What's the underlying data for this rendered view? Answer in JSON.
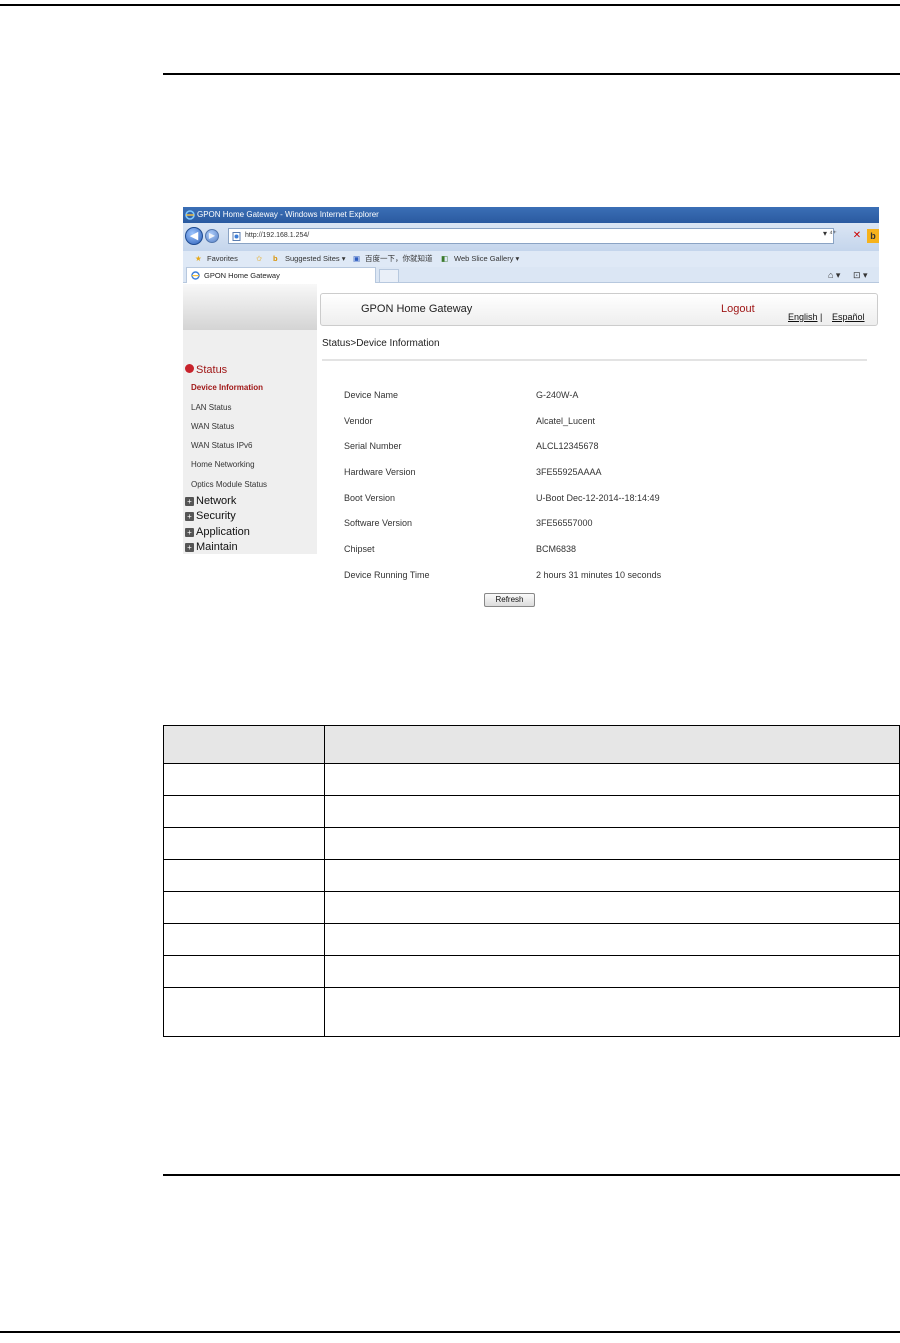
{
  "browser": {
    "window_title": "GPON Home Gateway - Windows Internet Explorer",
    "address": "http://192.168.1.254/",
    "favorites_label": "Favorites",
    "suggested_sites": "Suggested Sites ▾",
    "baidu_label": "百度一下，你就知道",
    "web_slice_gallery": "Web Slice Gallery ▾",
    "tab_label": "GPON Home Gateway",
    "addr_tools": "▾ ⁴⁺"
  },
  "header": {
    "title": "GPON Home Gateway",
    "logout": "Logout",
    "lang_english": "English",
    "lang_sep": "|",
    "lang_espanol": "Español"
  },
  "breadcrumb": "Status>Device Information",
  "sidebar": {
    "status": "Status",
    "sub_items": [
      "Device Information",
      "LAN Status",
      "WAN Status",
      "WAN Status IPv6",
      "Home Networking",
      "Optics Module Status"
    ],
    "network": "Network",
    "security": "Security",
    "application": "Application",
    "maintain": "Maintain"
  },
  "device_info": [
    {
      "label": "Device Name",
      "value": "G-240W-A"
    },
    {
      "label": "Vendor",
      "value": "Alcatel_Lucent"
    },
    {
      "label": "Serial Number",
      "value": "ALCL12345678"
    },
    {
      "label": "Hardware Version",
      "value": "3FE55925AAAA"
    },
    {
      "label": "Boot Version",
      "value": "U-Boot Dec-12-2014--18:14:49"
    },
    {
      "label": "Software Version",
      "value": "3FE56557000"
    },
    {
      "label": "Chipset",
      "value": "BCM6838"
    },
    {
      "label": "Device Running Time",
      "value": "2 hours 31 minutes 10 seconds"
    }
  ],
  "refresh_button": "Refresh",
  "colors": {
    "accent_red": "#a01818",
    "titlebar_blue": "#2a5aa0"
  }
}
